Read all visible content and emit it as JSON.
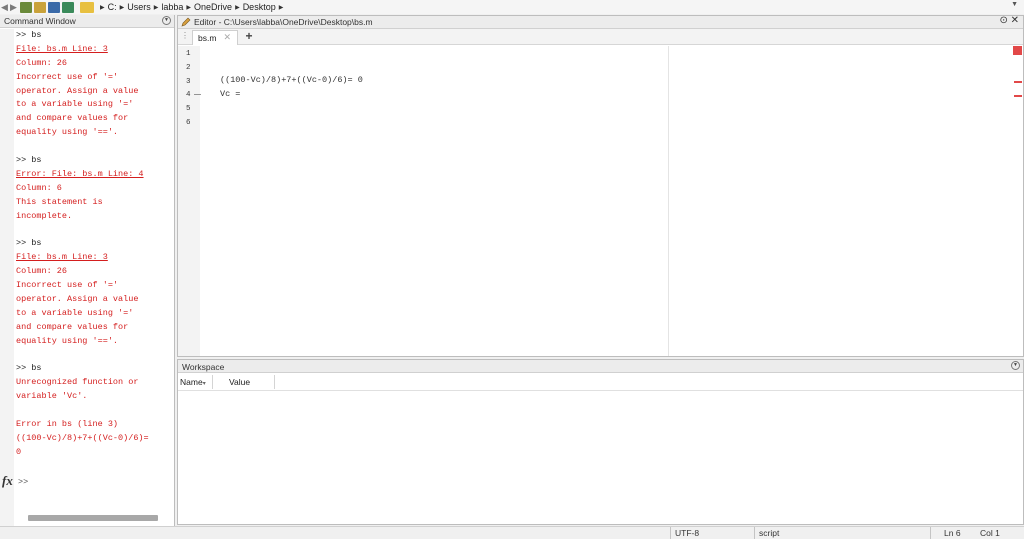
{
  "breadcrumb": [
    "C:",
    "Users",
    "labba",
    "OneDrive",
    "Desktop"
  ],
  "command_window": {
    "title": "Command Window",
    "lines": [
      {
        "text": ">> bs",
        "style": "prompt"
      },
      {
        "text": "File: bs.m Line: 3",
        "style": "err"
      },
      {
        "text": "Column: 26",
        "style": "err"
      },
      {
        "text": "Incorrect use of '='",
        "style": "err"
      },
      {
        "text": "operator. Assign a value",
        "style": "err"
      },
      {
        "text": "to a variable using '='",
        "style": "err"
      },
      {
        "text": "and compare values for",
        "style": "err"
      },
      {
        "text": "equality using '=='.",
        "style": "err"
      },
      {
        "text": "",
        "style": "prompt"
      },
      {
        "text": ">> bs",
        "style": "prompt"
      },
      {
        "text": "Error: File: bs.m Line: 4",
        "style": "err"
      },
      {
        "text": "Column: 6",
        "style": "err"
      },
      {
        "text": "This statement is",
        "style": "err"
      },
      {
        "text": "incomplete.",
        "style": "err"
      },
      {
        "text": "",
        "style": "prompt"
      },
      {
        "text": ">> bs",
        "style": "prompt"
      },
      {
        "text": "File: bs.m Line: 3",
        "style": "err"
      },
      {
        "text": "Column: 26",
        "style": "err"
      },
      {
        "text": "Incorrect use of '='",
        "style": "err"
      },
      {
        "text": "operator. Assign a value",
        "style": "err"
      },
      {
        "text": "to a variable using '='",
        "style": "err"
      },
      {
        "text": "and compare values for",
        "style": "err"
      },
      {
        "text": "equality using '=='.",
        "style": "err"
      },
      {
        "text": "",
        "style": "prompt"
      },
      {
        "text": ">> bs",
        "style": "prompt"
      },
      {
        "text": "Unrecognized function or",
        "style": "err"
      },
      {
        "text": "variable 'Vc'.",
        "style": "err"
      },
      {
        "text": "",
        "style": "prompt"
      },
      {
        "text": "Error in bs (line 3)",
        "style": "err"
      },
      {
        "text": "((100-Vc)/8)+7+((Vc-0)/6)=",
        "style": "err"
      },
      {
        "text": "0",
        "style": "err"
      }
    ],
    "prompt_symbol": ">>",
    "fx_label": "fx"
  },
  "editor": {
    "title": "Editor - C:\\Users\\labba\\OneDrive\\Desktop\\bs.m",
    "tab_label": "bs.m",
    "tab_close": "✕",
    "tab_add": "+",
    "line_numbers": [
      "1",
      "2",
      "3",
      "4",
      "5",
      "6"
    ],
    "code_lines": [
      "",
      "",
      "((100-Vc)/8)+7+((Vc-0)/6)= 0",
      "Vc ="
    ],
    "close_icon": "⊙ ✕"
  },
  "workspace": {
    "title": "Workspace",
    "columns": [
      "Name",
      "Value"
    ],
    "name_sort": "▾"
  },
  "status": {
    "encoding": "UTF-8",
    "type": "script",
    "line": "Ln  6",
    "col": "Col  1"
  },
  "colors": {
    "error_text": "#d41e1e",
    "error_marker": "#e24848"
  }
}
